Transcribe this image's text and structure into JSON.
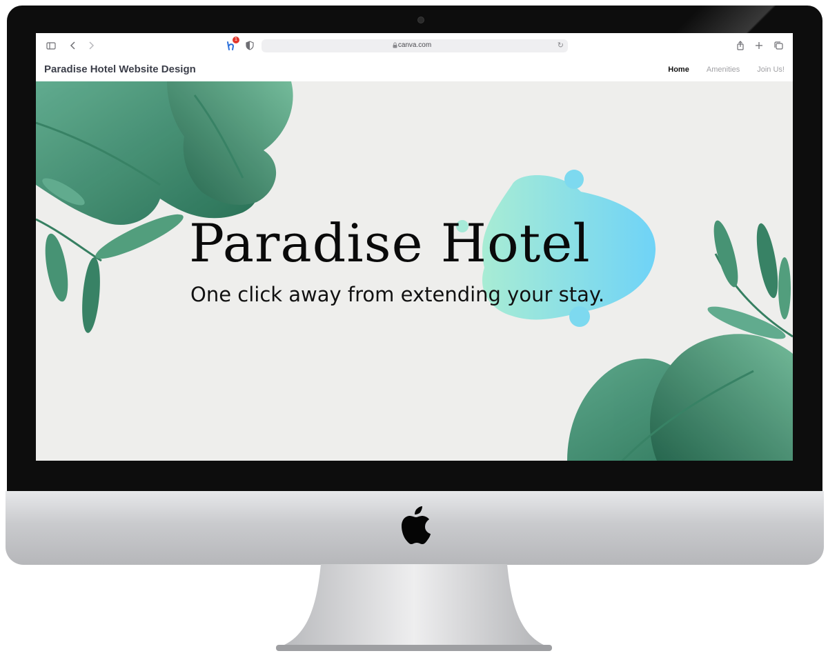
{
  "browser": {
    "url": "canva.com",
    "extension_badge": "1",
    "icons": [
      "sidebar-icon",
      "back-icon",
      "forward-icon",
      "extension-icon",
      "shield-icon",
      "lock-icon",
      "reload-icon",
      "share-icon",
      "new-tab-icon",
      "tabs-overview-icon"
    ]
  },
  "site": {
    "title": "Paradise Hotel Website Design",
    "nav": {
      "home": "Home",
      "amenities": "Amenities",
      "join": "Join Us!"
    }
  },
  "hero": {
    "title": "Paradise Hotel",
    "subtitle": "One click away from extending  your stay."
  },
  "colors": {
    "accent_gradient_start": "#a8ecd4",
    "accent_gradient_end": "#6fd3f7",
    "leaf_dark": "#1f6b4f",
    "leaf_light": "#5aa88a"
  }
}
